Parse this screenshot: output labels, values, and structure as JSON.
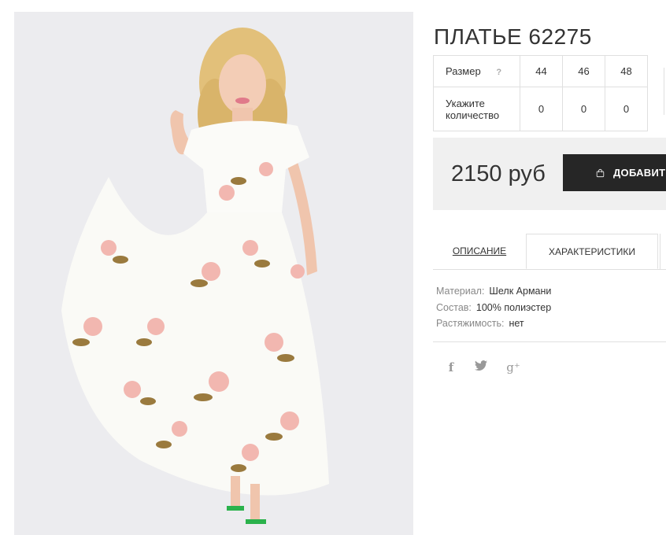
{
  "product": {
    "title": "ПЛАТЬЕ 62275",
    "photo_icon": "dress-photo"
  },
  "size_table": {
    "size_label": "Размер",
    "help_icon": "?",
    "sizes": [
      "44",
      "46",
      "48"
    ],
    "qty_label": "Укажите количество",
    "quantities": [
      "0",
      "0",
      "0"
    ]
  },
  "price_box": {
    "price": "2150 руб",
    "add_button_label": "ДОБАВИТЬ",
    "add_button_icon": "shopping-bag-icon"
  },
  "tabs": [
    {
      "label": "ОПИСАНИЕ",
      "active": false
    },
    {
      "label": "ХАРАКТЕРИСТИКИ",
      "active": true
    }
  ],
  "specs": [
    {
      "key": "Материал:",
      "value": "Шелк Армани"
    },
    {
      "key": "Состав:",
      "value": "100% полиэстер"
    },
    {
      "key": "Растяжимость:",
      "value": "нет"
    }
  ],
  "social": {
    "facebook": "f",
    "twitter": "🐦",
    "google_plus": "g⁺"
  },
  "colors": {
    "button_bg": "#262626",
    "price_bg": "#f0f0f0",
    "photo_bg": "#ececef"
  }
}
